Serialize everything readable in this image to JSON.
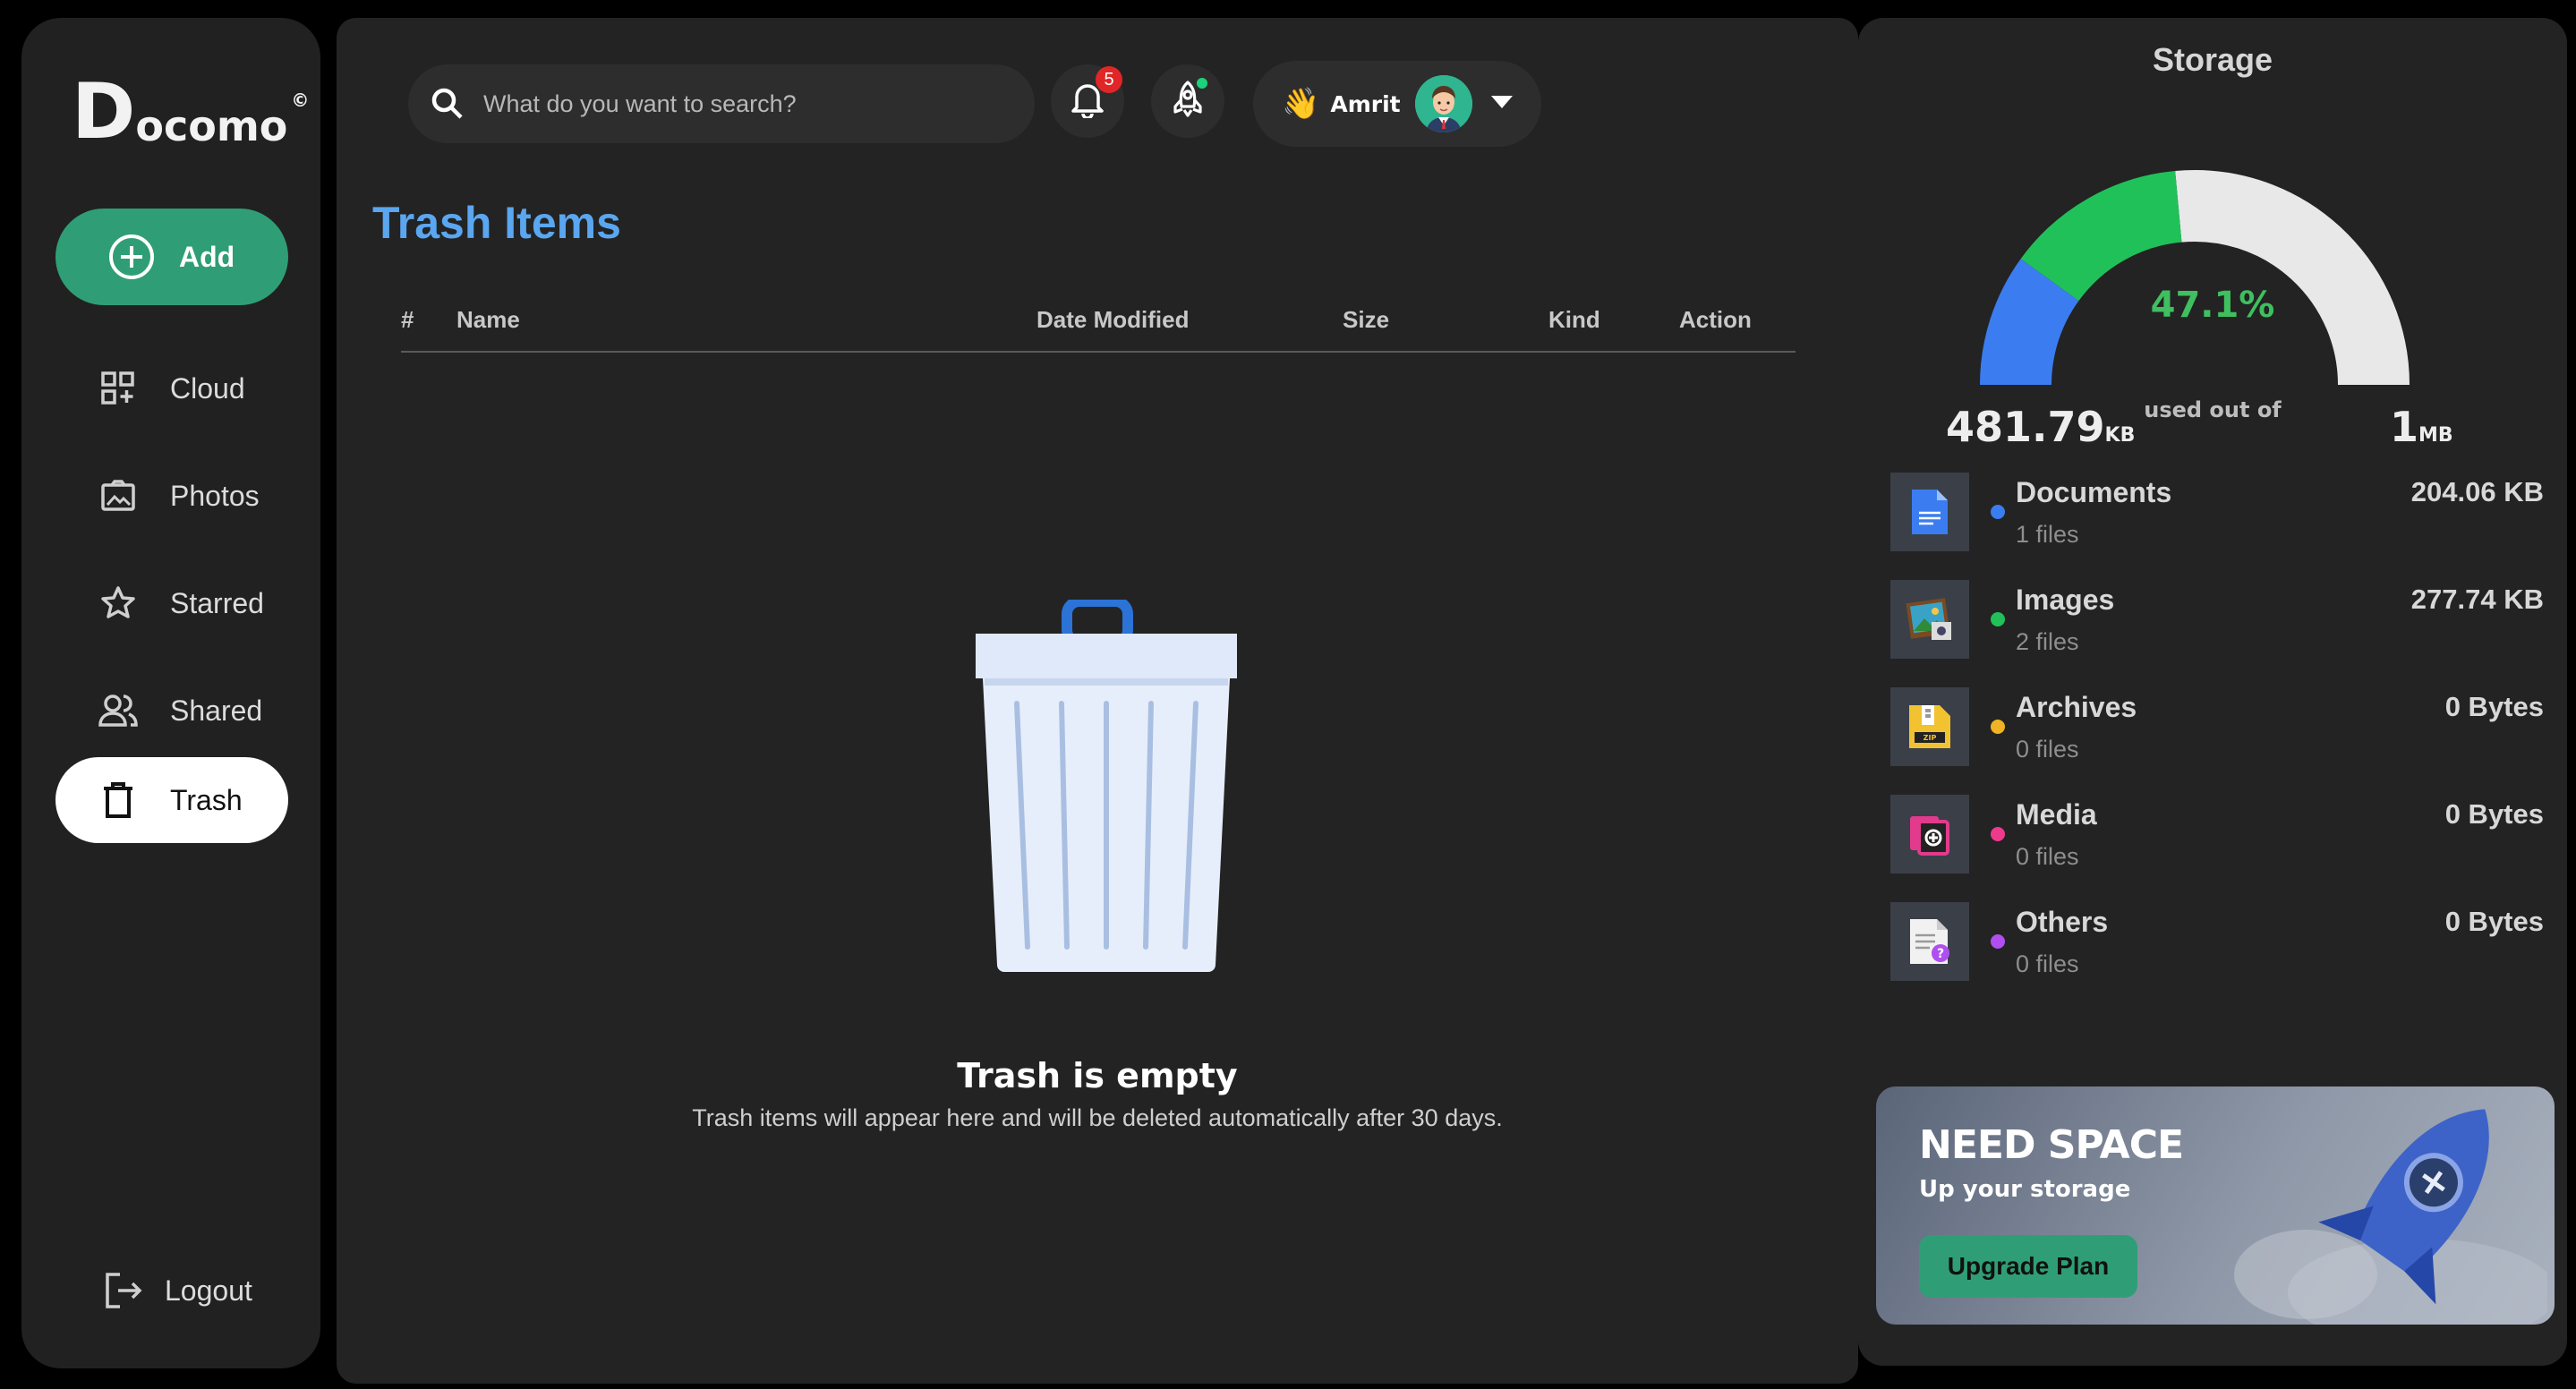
{
  "app": {
    "logo_first": "D",
    "logo_rest": "ocomo",
    "logo_mark": "©"
  },
  "sidebar": {
    "add_label": "Add",
    "items": [
      {
        "label": "Cloud",
        "icon": "grid-add-icon"
      },
      {
        "label": "Photos",
        "icon": "photo-icon"
      },
      {
        "label": "Starred",
        "icon": "star-icon"
      },
      {
        "label": "Shared",
        "icon": "users-icon"
      },
      {
        "label": "Trash",
        "icon": "trash-icon",
        "active": true
      }
    ],
    "logout_label": "Logout"
  },
  "header": {
    "search_placeholder": "What do you want to search?",
    "notification_count": "5",
    "user_name": "Amrit",
    "user_greeting_icon": "waving-hand-icon"
  },
  "main": {
    "title": "Trash Items",
    "columns": [
      "#",
      "Name",
      "Date Modified",
      "Size",
      "Kind",
      "Action"
    ],
    "empty_title": "Trash is empty",
    "empty_subtitle": "Trash items will appear here and will be deleted automatically after 30 days."
  },
  "storage": {
    "title": "Storage",
    "percent_label": "47.1%",
    "percent_used": 47.1,
    "used_value": "481.79",
    "used_unit": "KB",
    "used_label": "used out of",
    "total_value": "1",
    "total_unit": "MB",
    "gauge_colors": {
      "documents": "#3b7df0",
      "images": "#21c15a",
      "free": "#e8e8e8"
    },
    "categories": [
      {
        "name": "Documents",
        "count": "1 files",
        "size": "204.06 KB",
        "color": "#3b7df0",
        "icon": "document-icon"
      },
      {
        "name": "Images",
        "count": "2 files",
        "size": "277.74 KB",
        "color": "#21c15a",
        "icon": "image-icon"
      },
      {
        "name": "Archives",
        "count": "0 files",
        "size": "0 Bytes",
        "color": "#f0b323",
        "icon": "archive-icon"
      },
      {
        "name": "Media",
        "count": "0 files",
        "size": "0 Bytes",
        "color": "#ee3a8c",
        "icon": "media-icon"
      },
      {
        "name": "Others",
        "count": "0 files",
        "size": "0 Bytes",
        "color": "#b04ff0",
        "icon": "other-file-icon"
      }
    ],
    "promo": {
      "title": "NEED SPACE",
      "subtitle": "Up your storage",
      "button_label": "Upgrade Plan"
    }
  }
}
